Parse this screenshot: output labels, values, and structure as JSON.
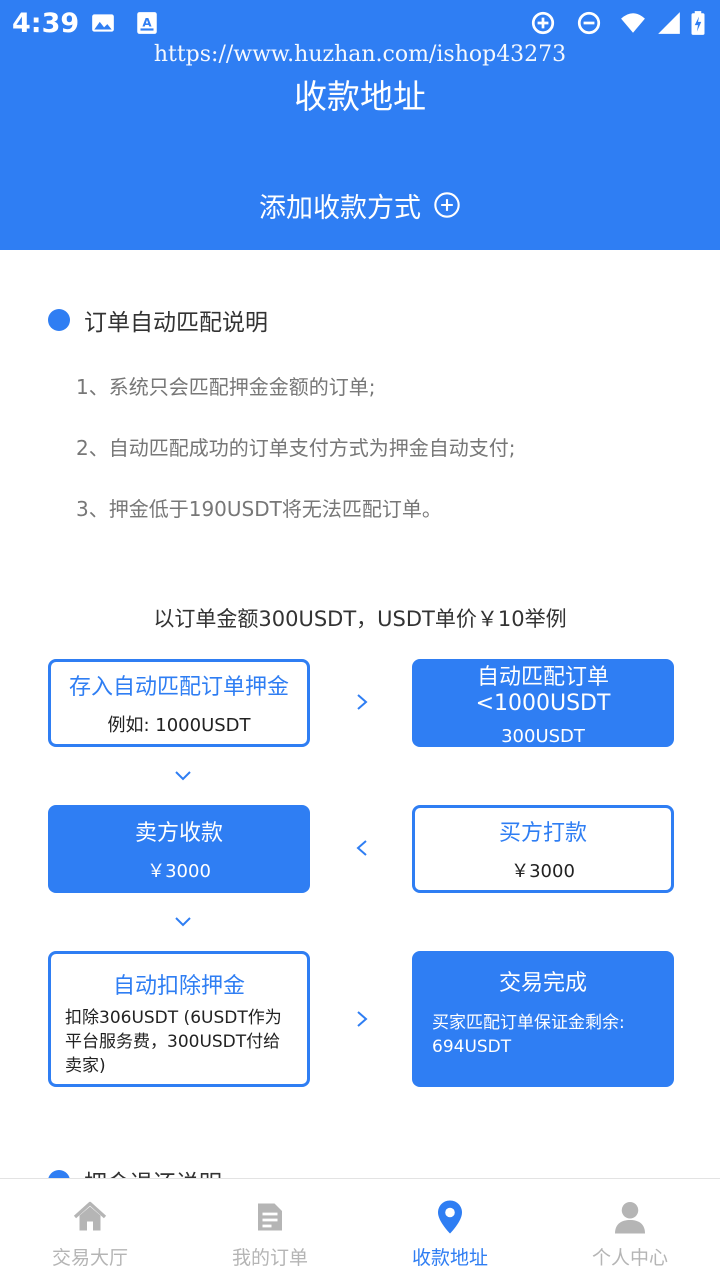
{
  "status_bar": {
    "time": "4:39"
  },
  "watermark": "https://www.huzhan.com/ishop43273",
  "header": {
    "title": "收款地址",
    "add_method_label": "添加收款方式"
  },
  "section1": {
    "title": "订单自动匹配说明",
    "rules": [
      "1、系统只会匹配押金金额的订单;",
      "2、自动匹配成功的订单支付方式为押金自动支付;",
      "3、押金低于190USDT将无法匹配订单。"
    ]
  },
  "example": {
    "title": "以订单金额300USDT，USDT单价￥10举例",
    "steps": {
      "deposit": {
        "title": "存入自动匹配订单押金",
        "sub": "例如: 1000USDT"
      },
      "match": {
        "title": "自动匹配订单 <1000USDT",
        "sub": "300USDT"
      },
      "buyer_pay": {
        "title": "买方打款",
        "sub": "￥3000"
      },
      "seller_receive": {
        "title": "卖方收款",
        "sub": "￥3000"
      },
      "deduct": {
        "title": "自动扣除押金",
        "desc": "扣除306USDT (6USDT作为平台服务费，300USDT付给卖家)"
      },
      "complete": {
        "title": "交易完成",
        "desc": "买家匹配订单保证金剩余: 694USDT"
      }
    }
  },
  "section2": {
    "title": "押金退还说明"
  },
  "nav": {
    "items": [
      {
        "label": "交易大厅",
        "icon": "home-icon",
        "active": false
      },
      {
        "label": "我的订单",
        "icon": "document-icon",
        "active": false
      },
      {
        "label": "收款地址",
        "icon": "location-pin-icon",
        "active": true
      },
      {
        "label": "个人中心",
        "icon": "user-icon",
        "active": false
      }
    ]
  },
  "colors": {
    "primary": "#2f7ef3",
    "inactive": "#b5b5b5",
    "rule_text": "#777777"
  }
}
